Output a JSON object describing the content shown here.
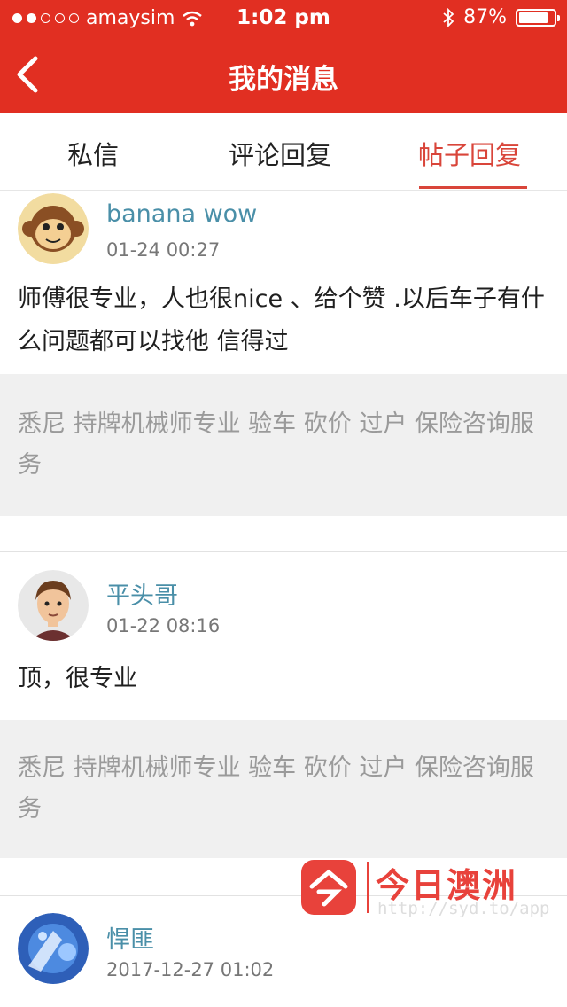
{
  "status_bar": {
    "carrier": "amaysim",
    "time": "1:02 pm",
    "battery": "87%"
  },
  "nav": {
    "title": "我的消息"
  },
  "tabs": [
    {
      "label": "私信"
    },
    {
      "label": "评论回复"
    },
    {
      "label": "帖子回复",
      "active": true
    }
  ],
  "posts": [
    {
      "user": "banana wow",
      "time": "01-24 00:27",
      "text": "师傅很专业，人也很nice 、给个赞 .以后车子有什么问题都可以找他 信得过",
      "quote": "悉尼 持牌机械师专业 验车 砍价 过户 保险咨询服务"
    },
    {
      "user": "平头哥",
      "time": "01-22 08:16",
      "text": "顶，很专业",
      "quote": "悉尼 持牌机械师专业 验车 砍价 过户 保险咨询服务"
    },
    {
      "user": "悍匪",
      "time": "2017-12-27 01:02"
    }
  ],
  "watermark": {
    "title": "今日澳洲",
    "url": "http://syd.to/app"
  },
  "colors": {
    "brand_red": "#e12f22",
    "active_tab": "#d9453a",
    "username": "#4a8fa8"
  }
}
